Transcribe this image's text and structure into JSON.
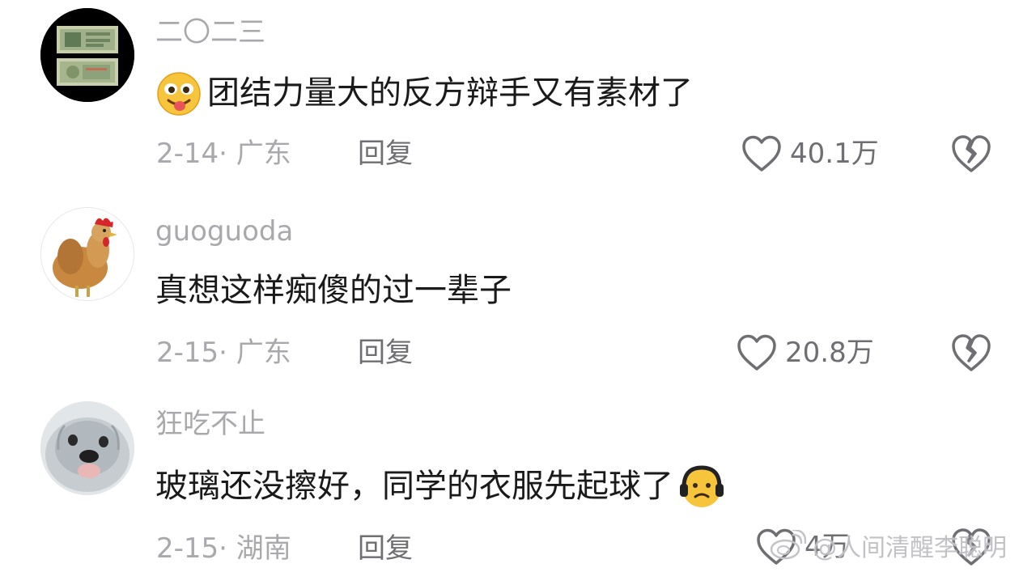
{
  "colors": {
    "username": "#a9a9ad",
    "content": "#1a1a1a",
    "meta": "#a9a9ad",
    "action": "#6e6e73",
    "icon_stroke": "#6e6e73"
  },
  "comments": [
    {
      "username": "二〇二三",
      "avatar": "banknote-avatar",
      "emoji_before": "drooling-face-emoji",
      "text": "团结力量大的反方辩手又有素材了",
      "date_location": "2-14· 广东",
      "reply_label": "回复",
      "like_count": "40.1万"
    },
    {
      "username": "guoguoda",
      "avatar": "rooster-avatar",
      "text": "真想这样痴傻的过一辈子",
      "date_location": "2-15· 广东",
      "reply_label": "回复",
      "like_count": "20.8万"
    },
    {
      "username": "狂吃不止",
      "avatar": "otter-avatar",
      "text": "玻璃还没擦好，同学的衣服先起球了",
      "emoji_after": "headphones-sad-face-emoji",
      "date_location": "2-15· 湖南",
      "reply_label": "回复",
      "like_count": "4万"
    }
  ],
  "watermark": {
    "text": "@人间清醒李聪明",
    "icon": "weibo-logo-icon"
  }
}
